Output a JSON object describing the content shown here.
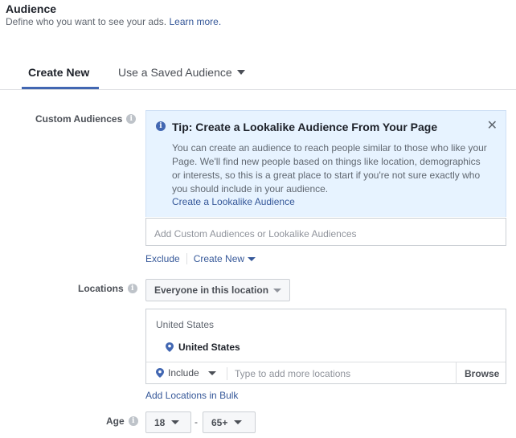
{
  "header": {
    "title": "Audience",
    "subtitle": "Define who you want to see your ads.",
    "learn_more": "Learn more."
  },
  "tabs": [
    {
      "label": "Create New",
      "active": true
    },
    {
      "label": "Use a Saved Audience",
      "active": false
    }
  ],
  "custom_audiences": {
    "label": "Custom Audiences",
    "tip": {
      "title": "Tip: Create a Lookalike Audience From Your Page",
      "body": "You can create an audience to reach people similar to those who like your Page. We'll find new people based on things like location, demographics or interests, so this is a great place to start if you're not sure exactly who you should include in your audience.",
      "link": "Create a Lookalike Audience"
    },
    "input_placeholder": "Add Custom Audiences or Lookalike Audiences",
    "exclude_label": "Exclude",
    "create_new_label": "Create New"
  },
  "locations": {
    "label": "Locations",
    "selector_value": "Everyone in this location",
    "country_heading": "United States",
    "selected_items": [
      "United States"
    ],
    "include_label": "Include",
    "search_placeholder": "Type to add more locations",
    "browse_label": "Browse",
    "bulk_link": "Add Locations in Bulk"
  },
  "age": {
    "label": "Age",
    "min": "18",
    "separator": "-",
    "max": "65+"
  },
  "colors": {
    "accent": "#4267b2",
    "link": "#365899",
    "tip_bg": "#e7f3ff"
  }
}
